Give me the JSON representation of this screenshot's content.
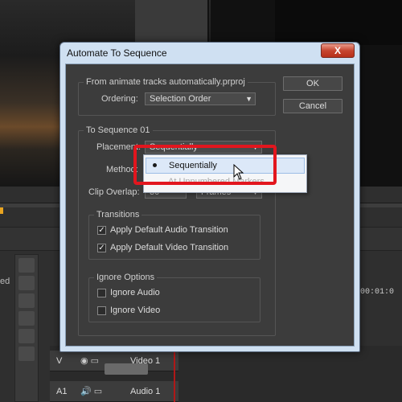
{
  "background": {
    "left_panel_text": "ed",
    "timecode": "00:01:0",
    "tracks": [
      {
        "label": "V",
        "name": "Video 1"
      },
      {
        "label": "A1",
        "name": "Audio 1"
      }
    ]
  },
  "dialog": {
    "title": "Automate To Sequence",
    "close_glyph": "X",
    "from_group": {
      "title": "From  animate tracks automatically.prproj",
      "ordering_label": "Ordering:",
      "ordering_value": "Selection Order"
    },
    "ok_label": "OK",
    "cancel_label": "Cancel",
    "to_group": {
      "title": "To Sequence 01",
      "placement_label": "Placement:",
      "placement_value": "Sequentially",
      "method_label": "Method:",
      "clip_overlap_label": "Clip Overlap:",
      "clip_overlap_value": "30",
      "clip_overlap_unit": "Frames"
    },
    "transitions": {
      "title": "Transitions",
      "audio_label": "Apply Default Audio Transition",
      "audio_checked": true,
      "video_label": "Apply Default Video Transition",
      "video_checked": true
    },
    "ignore_options": {
      "title": "Ignore Options",
      "audio_label": "Ignore Audio",
      "video_label": "Ignore Video"
    }
  },
  "placement_dropdown": {
    "options": [
      "Sequentially",
      "At Unnumbered Markers"
    ],
    "selected": "Sequentially"
  },
  "annotation_color": "#e2161e"
}
